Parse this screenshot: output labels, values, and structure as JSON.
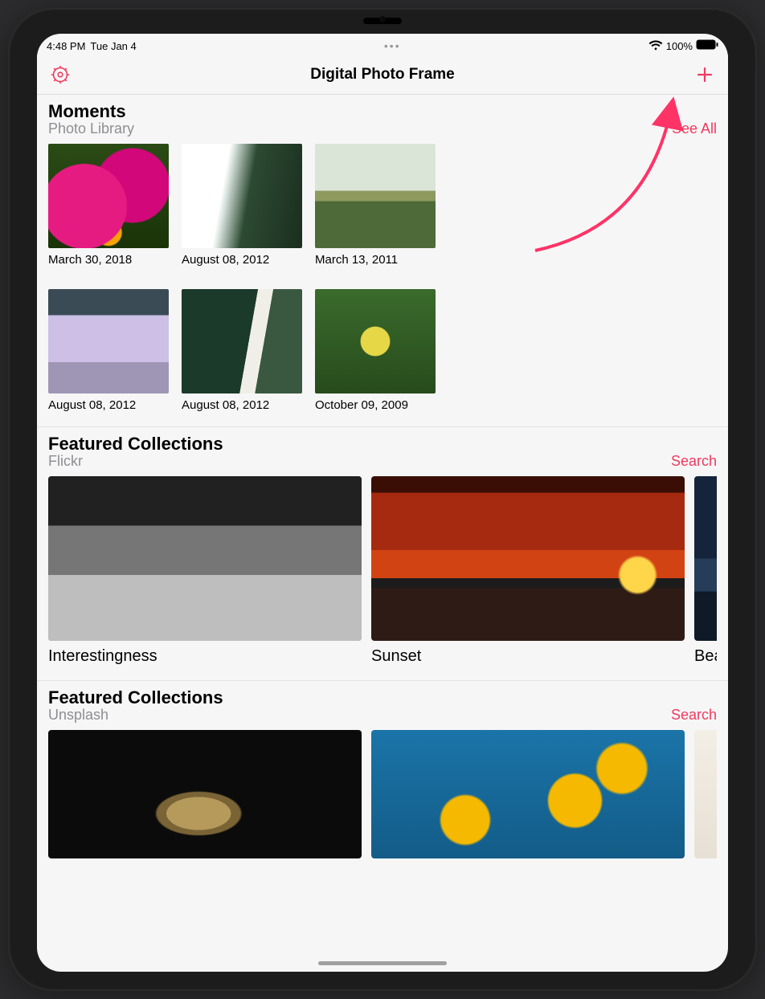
{
  "status": {
    "time": "4:48 PM",
    "date": "Tue Jan 4",
    "battery_text": "100%"
  },
  "nav": {
    "title": "Digital Photo Frame",
    "settings_icon": "gear-icon",
    "add_icon": "plus-icon"
  },
  "sections": {
    "moments": {
      "title": "Moments",
      "subtitle": "Photo Library",
      "link": "See All",
      "items": [
        {
          "caption": "March 30, 2018",
          "art": "flowers"
        },
        {
          "caption": "August 08, 2012",
          "art": "waterfall1"
        },
        {
          "caption": "March 13, 2011",
          "art": "meadow"
        },
        {
          "caption": "August 08, 2012",
          "art": "icefall"
        },
        {
          "caption": "August 08, 2012",
          "art": "waterfall2"
        },
        {
          "caption": "October 09, 2009",
          "art": "leaves"
        }
      ]
    },
    "flickr": {
      "title": "Featured Collections",
      "subtitle": "Flickr",
      "link": "Search",
      "items": [
        {
          "caption": "Interestingness",
          "art": "street"
        },
        {
          "caption": "Sunset",
          "art": "sunset"
        },
        {
          "caption": "Beac",
          "art": "beach"
        }
      ]
    },
    "unsplash": {
      "title": "Featured Collections",
      "subtitle": "Unsplash",
      "link": "Search",
      "items": [
        {
          "caption": "",
          "art": "coins"
        },
        {
          "caption": "",
          "art": "poppies"
        },
        {
          "caption": "",
          "art": "minimal"
        }
      ]
    }
  },
  "colors": {
    "accent": "#ef3a5d"
  }
}
